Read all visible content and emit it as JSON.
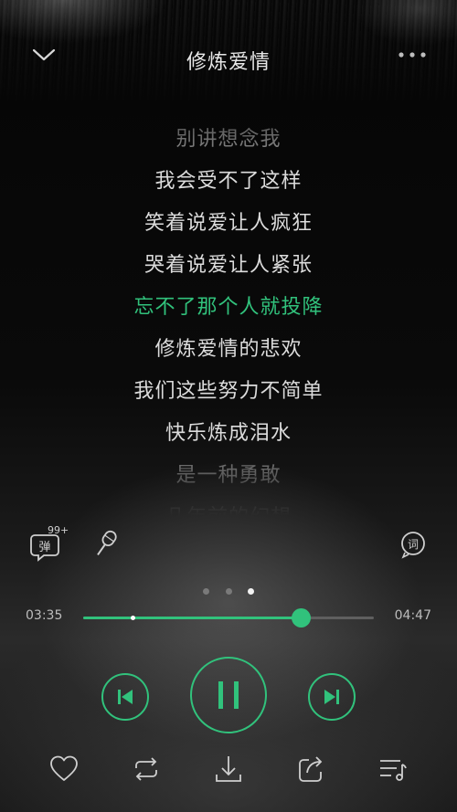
{
  "header": {
    "title": "修炼爱情",
    "back_icon": "chevron-down-icon",
    "more_icon": "more-dots-icon"
  },
  "lyrics": {
    "lines": [
      {
        "text": "别讲想念我",
        "state": "dim"
      },
      {
        "text": "我会受不了这样",
        "state": "normal"
      },
      {
        "text": "笑着说爱让人疯狂",
        "state": "normal"
      },
      {
        "text": "哭着说爱让人紧张",
        "state": "normal"
      },
      {
        "text": "忘不了那个人就投降",
        "state": "active"
      },
      {
        "text": "修炼爱情的悲欢",
        "state": "normal"
      },
      {
        "text": "我们这些努力不简单",
        "state": "normal"
      },
      {
        "text": "快乐炼成泪水",
        "state": "normal"
      },
      {
        "text": "是一种勇敢",
        "state": "dim"
      },
      {
        "text": "几年前的幻想",
        "state": "dim"
      }
    ]
  },
  "tools": {
    "danmu_label": "弹",
    "danmu_count": "99+",
    "lyric_label": "词",
    "mic_icon": "microphone-icon"
  },
  "pager": {
    "count": 3,
    "active_index": 2
  },
  "player": {
    "current_time": "03:35",
    "total_time": "04:47",
    "progress_fraction": 0.7491,
    "buffer_marker_fraction": 0.17,
    "state": "playing"
  },
  "bottom_bar": {
    "items": [
      "heart-icon",
      "repeat-icon",
      "download-icon",
      "share-icon",
      "playlist-icon"
    ]
  },
  "colors": {
    "accent": "#31c27c",
    "text": "#dcdcdc",
    "dim_text": "#8a8a8a",
    "background": "#0a0a0a"
  }
}
